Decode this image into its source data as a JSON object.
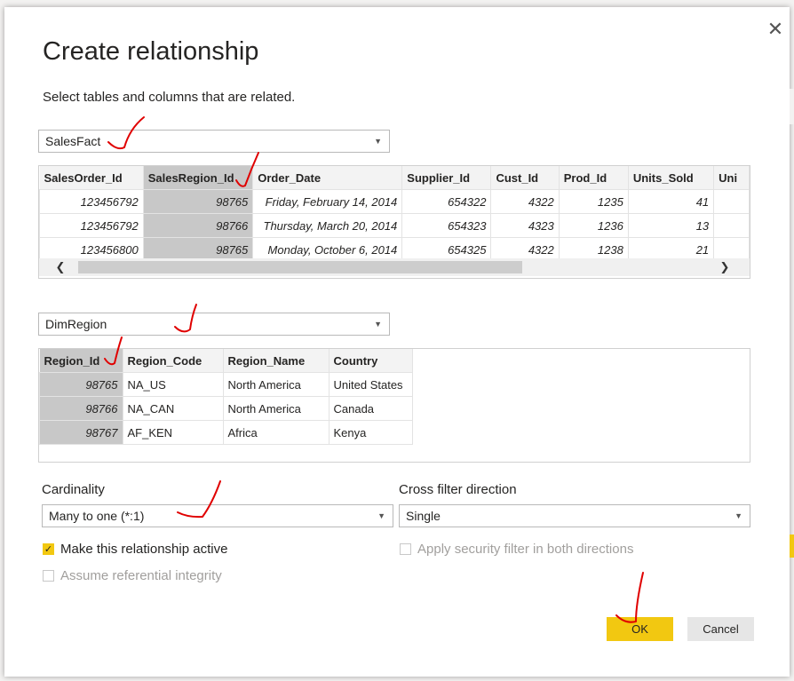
{
  "dialog": {
    "title": "Create relationship",
    "subtitle": "Select tables and columns that are related.",
    "close_icon": "close-icon"
  },
  "table1": {
    "selected": "SalesFact",
    "columns": [
      "SalesOrder_Id",
      "SalesRegion_Id",
      "Order_Date",
      "Supplier_Id",
      "Cust_Id",
      "Prod_Id",
      "Units_Sold",
      "Uni"
    ],
    "rows": [
      [
        "123456792",
        "98765",
        "Friday, February 14, 2014",
        "654322",
        "4322",
        "1235",
        "41",
        ""
      ],
      [
        "123456792",
        "98766",
        "Thursday, March 20, 2014",
        "654323",
        "4323",
        "1236",
        "13",
        ""
      ],
      [
        "123456800",
        "98765",
        "Monday, October 6, 2014",
        "654325",
        "4322",
        "1238",
        "21",
        ""
      ]
    ],
    "selected_column": "SalesRegion_Id"
  },
  "table2": {
    "selected": "DimRegion",
    "columns": [
      "Region_Id",
      "Region_Code",
      "Region_Name",
      "Country"
    ],
    "rows": [
      [
        "98765",
        "NA_US",
        "North America",
        "United States"
      ],
      [
        "98766",
        "NA_CAN",
        "North America",
        "Canada"
      ],
      [
        "98767",
        "AF_KEN",
        "Africa",
        "Kenya"
      ]
    ],
    "selected_column": "Region_Id"
  },
  "cardinality": {
    "label": "Cardinality",
    "value": "Many to one (*:1)"
  },
  "cross_filter": {
    "label": "Cross filter direction",
    "value": "Single"
  },
  "options": {
    "active_label": "Make this relationship active",
    "active_checked": true,
    "security_label": "Apply security filter in both directions",
    "security_checked": false,
    "integrity_label": "Assume referential integrity",
    "integrity_checked": false
  },
  "buttons": {
    "ok": "OK",
    "cancel": "Cancel"
  },
  "colors": {
    "accent": "#f2c811",
    "selected_column": "#c8c8c8",
    "annotation": "#e00000"
  }
}
